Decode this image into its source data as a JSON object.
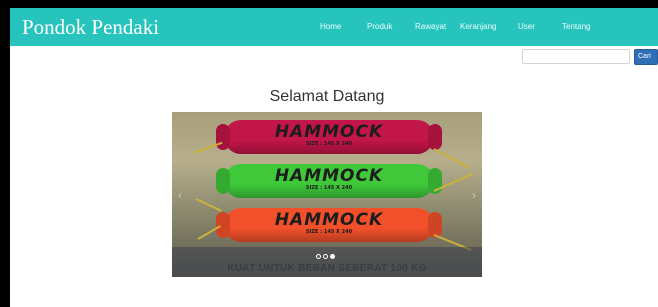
{
  "navbar": {
    "brand": "Pondok Pendaki",
    "links": [
      "Home",
      "Produk",
      "Rawayat",
      "Keranjang",
      "User",
      "Tentang"
    ]
  },
  "search": {
    "placeholder": "",
    "button_label": "Cari"
  },
  "main": {
    "heading": "Selamat Datang"
  },
  "carousel": {
    "caption": "KUAT UNTUK BEBAN SEBERAT 100 KG",
    "slide_count": 3,
    "active_index": 2,
    "products": [
      {
        "label": "HAMMOCK",
        "size": "SIZE : 145 X 240",
        "color": "#c21549"
      },
      {
        "label": "HAMMOCK",
        "size": "SIZE : 145 X 240",
        "color": "#3ec83a"
      },
      {
        "label": "HAMMOCK",
        "size": "SIZE : 145 X 240",
        "color": "#f2502b"
      }
    ]
  },
  "colors": {
    "navbar": "#27c3bd",
    "search_button": "#2f6fb8"
  }
}
